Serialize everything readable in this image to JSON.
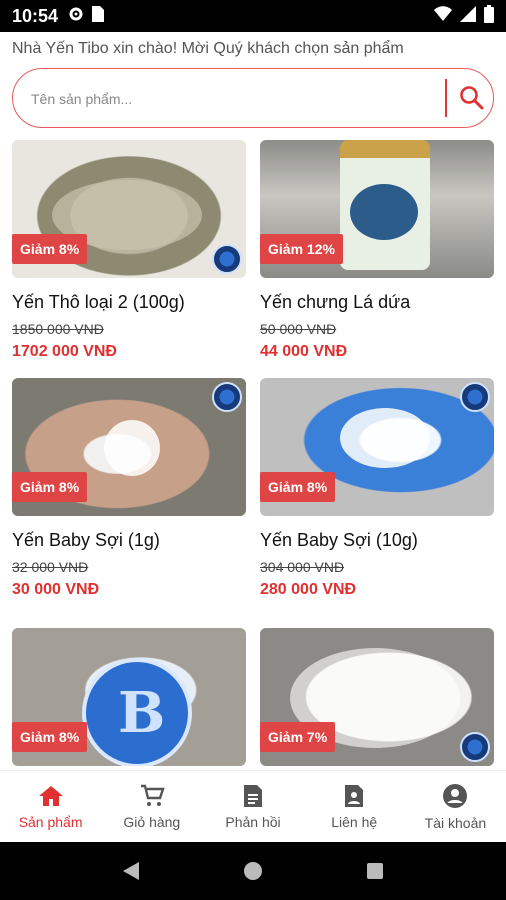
{
  "status_bar": {
    "time": "10:54"
  },
  "header": {
    "greeting": "Nhà Yến Tibo xin chào! Mời Quý khách chọn sản phẩm"
  },
  "search": {
    "placeholder": "Tên sản phẩm..."
  },
  "products": [
    {
      "name": "Yến Thô loại 2 (100g)",
      "old_price": "1850 000 VNĐ",
      "new_price": "1702 000 VNĐ",
      "discount": "Giảm 8%"
    },
    {
      "name": "Yến chưng Lá dứa",
      "old_price": "50 000 VNĐ",
      "new_price": "44 000 VNĐ",
      "discount": "Giảm 12%"
    },
    {
      "name": "Yến Baby Sợi (1g)",
      "old_price": "32 000 VNĐ",
      "new_price": "30 000 VNĐ",
      "discount": "Giảm 8%"
    },
    {
      "name": "Yến Baby Sợi (10g)",
      "old_price": "304 000 VNĐ",
      "new_price": "280 000 VNĐ",
      "discount": "Giảm 8%"
    },
    {
      "discount": "Giảm 8%"
    },
    {
      "discount": "Giảm 7%"
    }
  ],
  "nav": {
    "items": [
      {
        "label": "Sản phẩm",
        "icon": "home-icon",
        "active": true
      },
      {
        "label": "Giỏ hàng",
        "icon": "cart-icon",
        "active": false
      },
      {
        "label": "Phản hồi",
        "icon": "document-icon",
        "active": false
      },
      {
        "label": "Liên hệ",
        "icon": "contact-icon",
        "active": false
      },
      {
        "label": "Tài khoản",
        "icon": "account-icon",
        "active": false
      }
    ]
  },
  "colors": {
    "accent": "#e03030",
    "badge": "#e04545",
    "search_border": "#e85a5a"
  }
}
